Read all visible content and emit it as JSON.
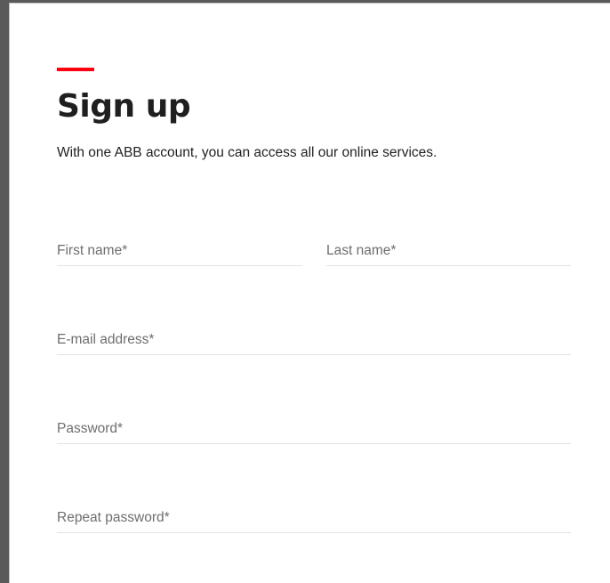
{
  "form": {
    "title": "Sign up",
    "subtitle": "With one ABB account, you can access all our online services.",
    "accent_color": "#ff000f",
    "fields": {
      "first_name": {
        "placeholder": "First name*",
        "value": ""
      },
      "last_name": {
        "placeholder": "Last name*",
        "value": ""
      },
      "email": {
        "placeholder": "E-mail address*",
        "value": ""
      },
      "password": {
        "placeholder": "Password*",
        "value": ""
      },
      "repeat_password": {
        "placeholder": "Repeat password*",
        "value": ""
      }
    }
  }
}
